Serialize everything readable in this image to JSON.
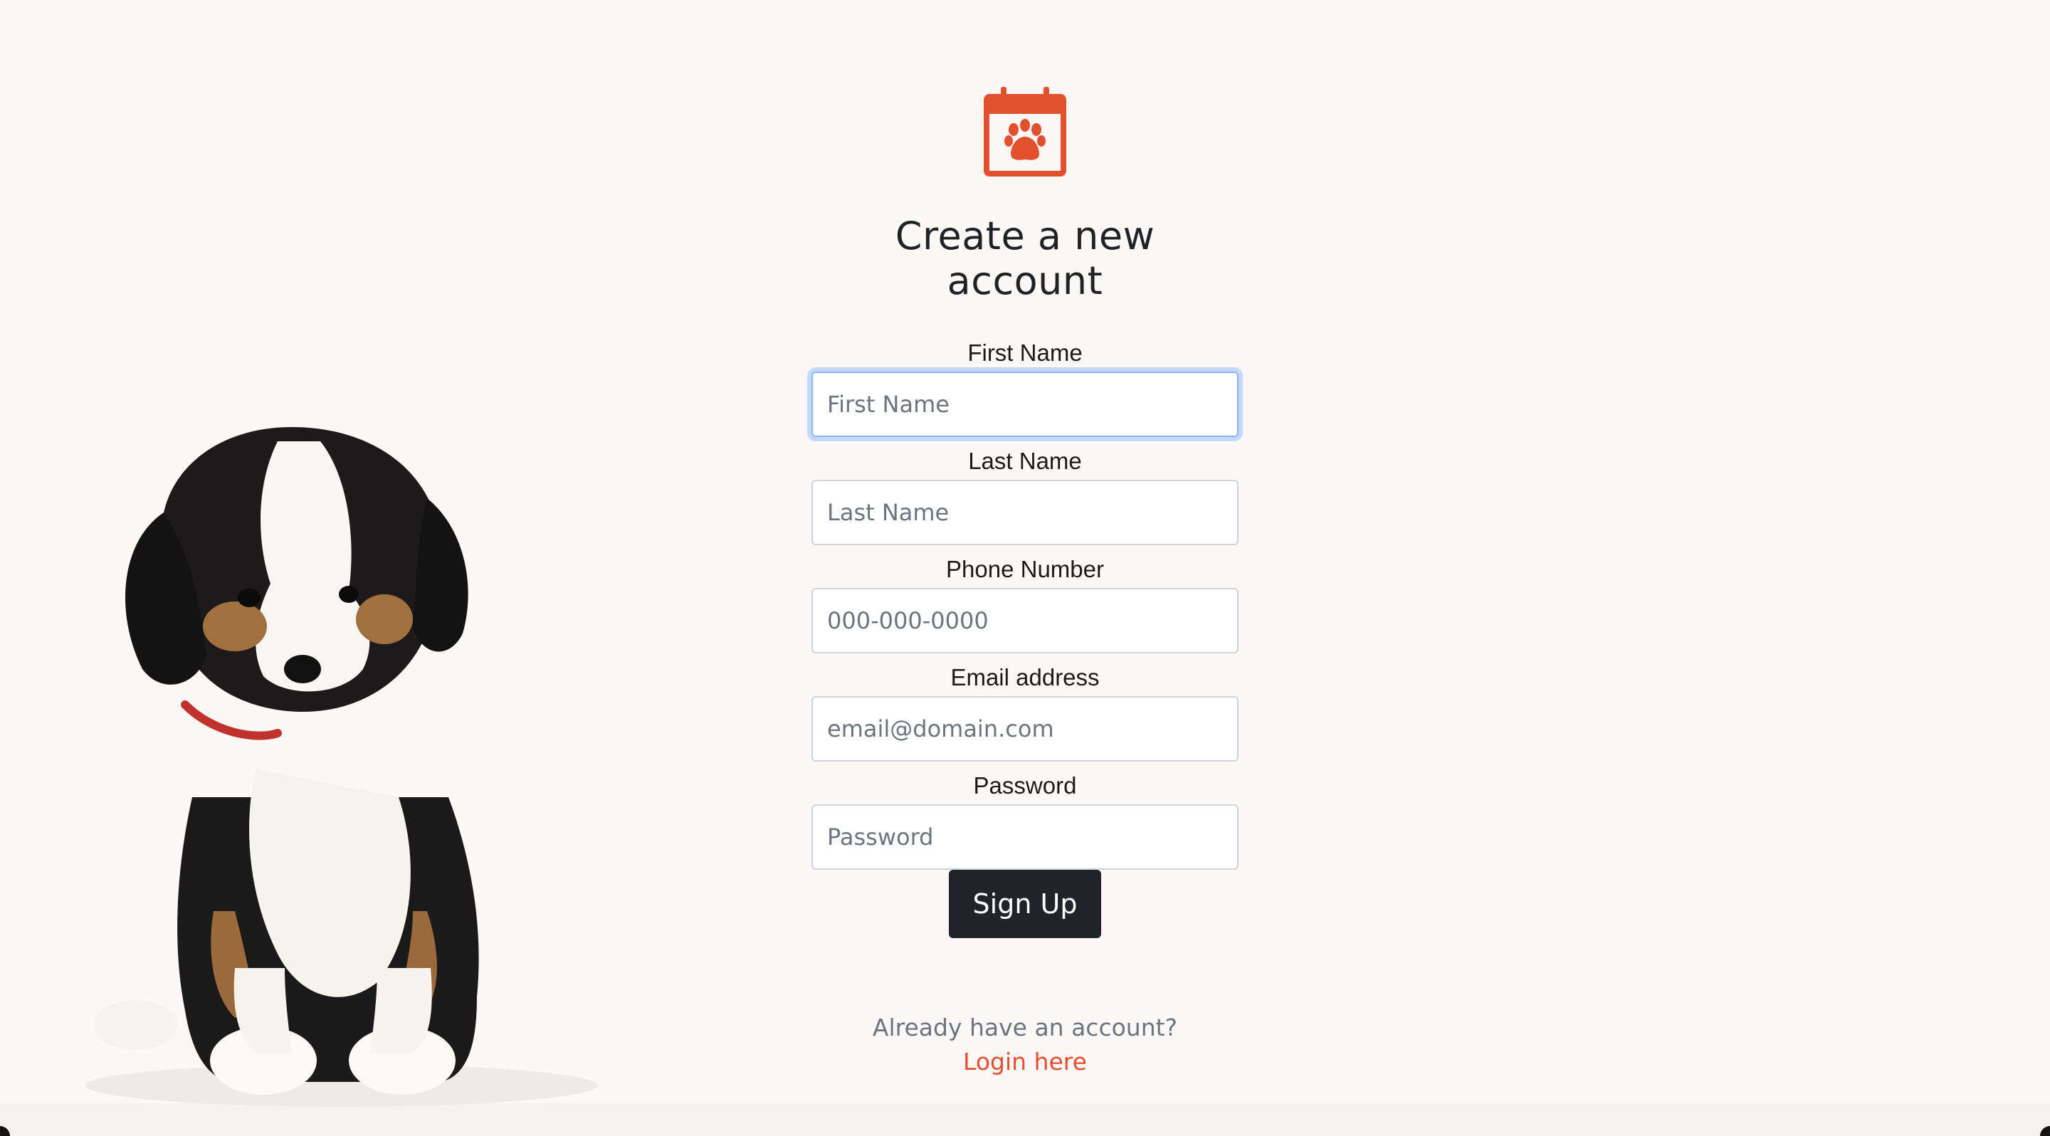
{
  "brand": {
    "accent_color": "#e2502d",
    "logo_icon": "calendar-paw-icon"
  },
  "page": {
    "title": "Create a new account"
  },
  "form": {
    "fields": [
      {
        "label": "First Name",
        "placeholder": "First Name",
        "value": "",
        "focused": true
      },
      {
        "label": "Last Name",
        "placeholder": "Last Name",
        "value": ""
      },
      {
        "label": "Phone Number",
        "placeholder": "000-000-0000",
        "value": ""
      },
      {
        "label": "Email address",
        "placeholder": "email@domain.com",
        "value": ""
      },
      {
        "label": "Password",
        "placeholder": "Password",
        "value": ""
      }
    ],
    "submit_label": "Sign Up"
  },
  "footer": {
    "prompt": "Already have an account?",
    "login_link": "Login here"
  }
}
